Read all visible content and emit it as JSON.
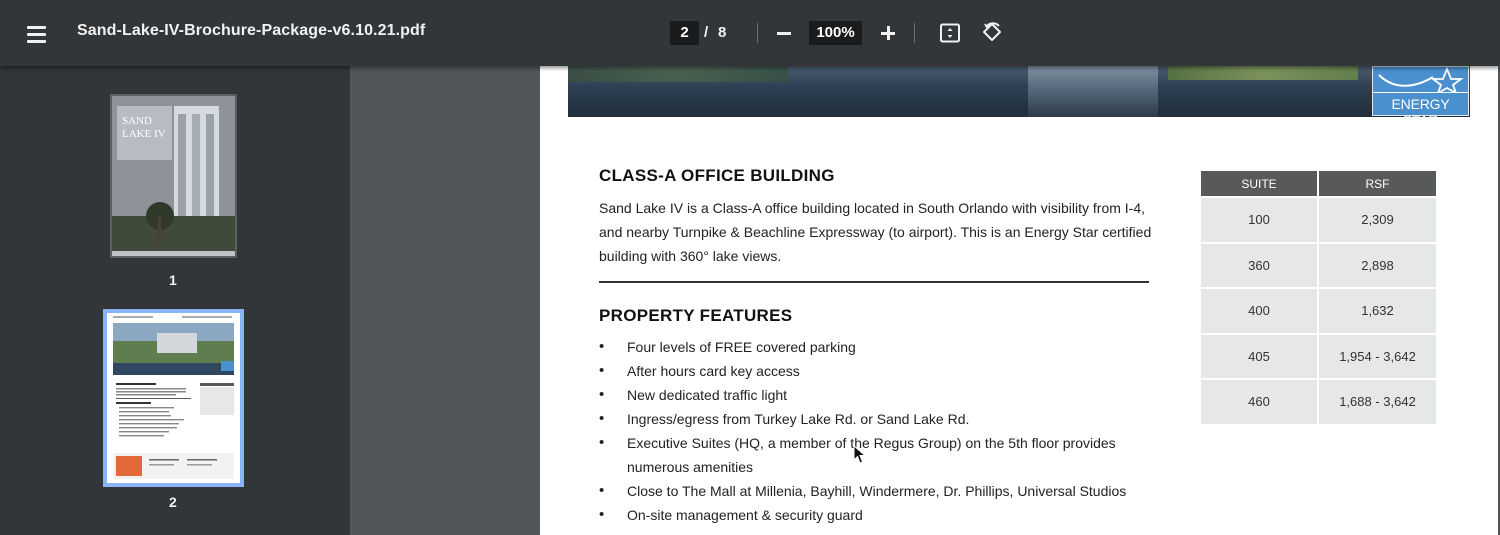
{
  "toolbar": {
    "menu_icon": "hamburger-menu-icon",
    "file_title": "Sand-Lake-IV-Brochure-Package-v6.10.21.pdf",
    "current_page": "2",
    "page_separator": "/",
    "total_pages": "8",
    "zoom_level": "100%",
    "zoom_out_icon": "minus-icon",
    "zoom_in_icon": "plus-icon",
    "fit_icon": "fit-to-page-icon",
    "rotate_icon": "rotate-counterclockwise-icon"
  },
  "sidebar": {
    "thumbnails": [
      {
        "label": "1",
        "cover_title": "SAND\nLAKE IV",
        "selected": false
      },
      {
        "label": "2",
        "selected": true
      }
    ]
  },
  "document": {
    "energy_star_label": "ENERGY STAR",
    "class_heading": "CLASS-A OFFICE BUILDING",
    "class_body": "Sand Lake IV is a Class-A office building located in South Orlando with visibility from I-4, and nearby Turnpike & Beachline Expressway (to airport). This is an Energy Star certified building with 360° lake views.",
    "features_heading": "PROPERTY FEATURES",
    "features": [
      "Four levels of FREE covered parking",
      "After hours card key access",
      "New dedicated traffic light",
      "Ingress/egress from Turkey Lake Rd. or Sand Lake Rd.",
      "Executive Suites (HQ, a member of the Regus Group) on the 5th floor provides numerous amenities",
      "Close to The Mall at Millenia, Bayhill, Windermere, Dr. Phillips, Universal Studios",
      "On-site management & security guard"
    ],
    "suite_table": {
      "headers": [
        "SUITE",
        "RSF"
      ],
      "rows": [
        [
          "100",
          "2,309"
        ],
        [
          "360",
          "2,898"
        ],
        [
          "400",
          "1,632"
        ],
        [
          "405",
          "1,954 - 3,642"
        ],
        [
          "460",
          "1,688 - 3,642"
        ]
      ]
    }
  },
  "colors": {
    "toolbar_bg": "#323639",
    "viewer_bg": "#525659",
    "selected_thumb_border": "#8ab4f8",
    "table_header": "#58595b",
    "table_cell": "#e6e7e8",
    "energy_star_blue": "#4a8fce"
  }
}
